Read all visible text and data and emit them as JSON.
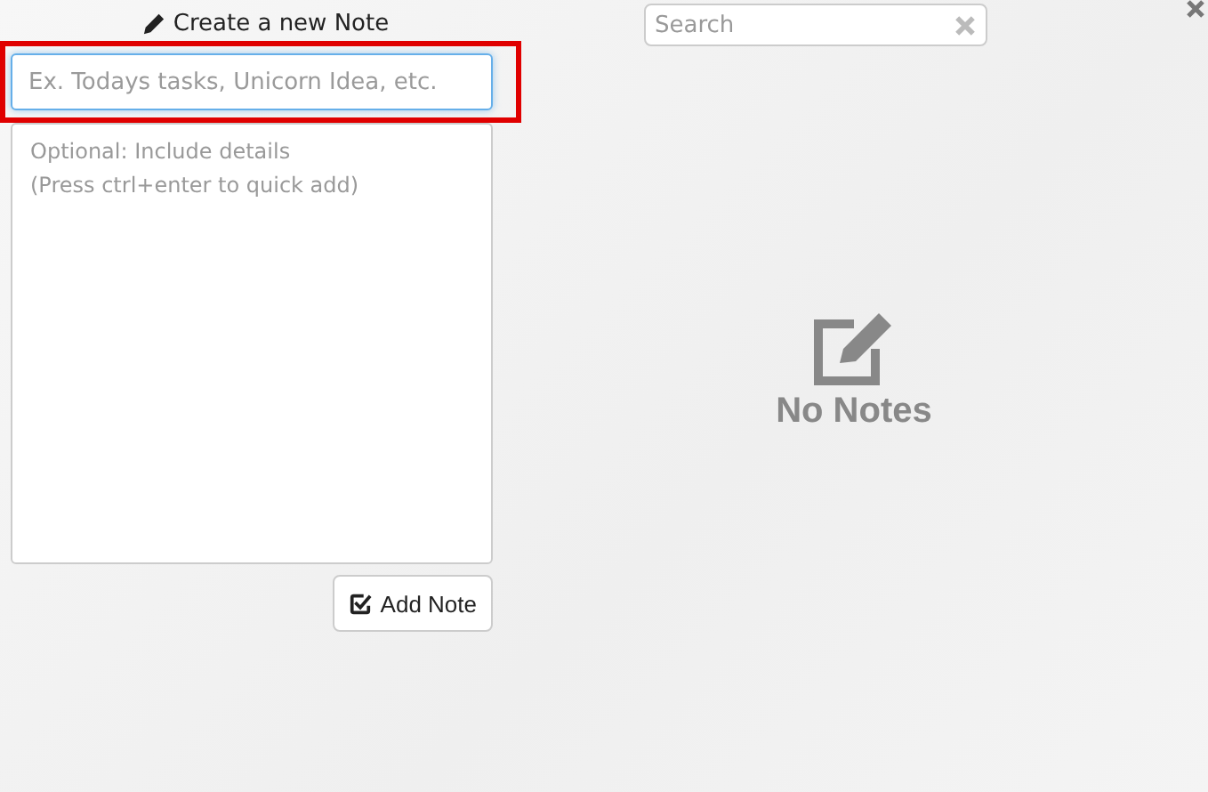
{
  "create_panel": {
    "heading": "Create a new Note",
    "title_field": {
      "placeholder": "Ex. Todays tasks, Unicorn Idea, etc.",
      "highlighted": true
    },
    "details_field": {
      "placeholder": "Optional: Include details\n(Press ctrl+enter to quick add)"
    },
    "add_button": "Add Note"
  },
  "search": {
    "placeholder": "Search"
  },
  "empty_state": {
    "message": "No Notes"
  }
}
